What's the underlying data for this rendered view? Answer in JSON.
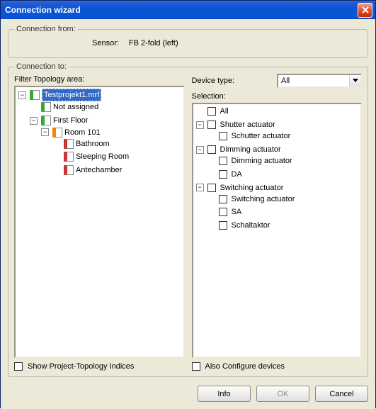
{
  "title": "Connection wizard",
  "from": {
    "legend": "Connection from:",
    "sensor_label": "Sensor:",
    "sensor_value": "FB 2-fold (left)"
  },
  "to": {
    "legend": "Connection to:",
    "filter_label": "Filter Topology area:",
    "tree": {
      "project": "Testprojekt1.mrf",
      "not_assigned": "Not assigned",
      "first_floor": "First Floor",
      "room101": "Room 101",
      "bathroom": "Bathroom",
      "sleeping": "Sleeping Room",
      "ante": "Antechamber"
    },
    "device_type_label": "Device type:",
    "device_type_value": "All",
    "selection_label": "Selection:",
    "selection": {
      "all": "All",
      "shutter_act": "Shutter actuator",
      "schutter_act": "Schutter actuator",
      "dimming_act": "Dimming actuator",
      "dimming_act2": "Dimming actuator",
      "da": "DA",
      "switching_act": "Switching actuator",
      "switching_act2": "Switching actuator",
      "sa": "SA",
      "schaltaktor": "Schaltaktor"
    },
    "show_indices": "Show Project-Topology Indices",
    "also_configure": "Also Configure devices"
  },
  "buttons": {
    "info": "Info",
    "ok": "OK",
    "cancel": "Cancel"
  }
}
